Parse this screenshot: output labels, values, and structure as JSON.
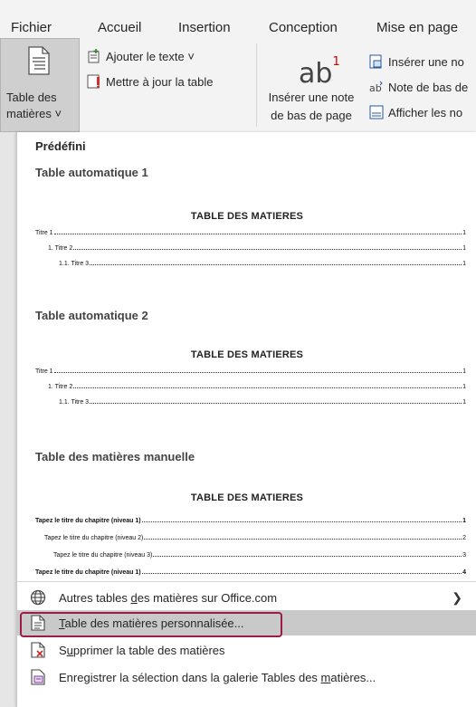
{
  "tabs": [
    "Fichier",
    "Accueil",
    "Insertion",
    "Conception",
    "Mise en page"
  ],
  "ribbon": {
    "toc_button_line1": "Table des",
    "toc_button_line2": "matières ˅",
    "add_text": "Ajouter le texte ˅",
    "update_table": "Mettre à jour la table",
    "insert_footnote_line1": "Insérer une note",
    "insert_footnote_line2": "de bas de page",
    "insert_endnote": "Insérer une no",
    "next_footnote": "Note de bas de",
    "show_notes": "Afficher les no"
  },
  "gallery": {
    "header": "Prédéfini",
    "auto1": {
      "name": "Table automatique 1",
      "title": "TABLE DES MATIERES",
      "lines": [
        {
          "text": "Titre 1",
          "page": "1"
        },
        {
          "text": "1.    Titre 2",
          "page": "1"
        },
        {
          "text": "1.1.     Titre 3",
          "page": "1"
        }
      ]
    },
    "auto2": {
      "name": "Table automatique 2",
      "title": "TABLE DES MATIERES",
      "lines": [
        {
          "text": "Titre 1",
          "page": "1"
        },
        {
          "text": "1.    Titre 2",
          "page": "1"
        },
        {
          "text": "1.1.     Titre 3",
          "page": "1"
        }
      ]
    },
    "manual": {
      "name": "Table des matières manuelle",
      "title": "TABLE DES MATIERES",
      "lines": [
        {
          "text": "Tapez le titre du chapitre (niveau 1)",
          "page": "1"
        },
        {
          "text": "Tapez le titre du chapitre (niveau 2)",
          "page": "2"
        },
        {
          "text": "Tapez le titre du chapitre (niveau 3)",
          "page": "3"
        },
        {
          "text": "Tapez le titre du chapitre (niveau 1)",
          "page": "4"
        }
      ]
    }
  },
  "menu": {
    "more_tocs_pre": "Autres tables ",
    "more_tocs_u": "d",
    "more_tocs_post": "es matières sur Office.com",
    "custom_toc_u": "T",
    "custom_toc_post": "able des matières personnalisée...",
    "remove_toc_pre": "S",
    "remove_toc_u": "u",
    "remove_toc_post": "pprimer la table des matières",
    "save_selection_pre": "Enregistrer la sélection dans la galerie Tables des ",
    "save_selection_u": "m",
    "save_selection_post": "atières..."
  },
  "colors": {
    "highlight_border": "#9b1c47",
    "hover_bg": "#c9c9c9",
    "accent": "#2b579a"
  }
}
